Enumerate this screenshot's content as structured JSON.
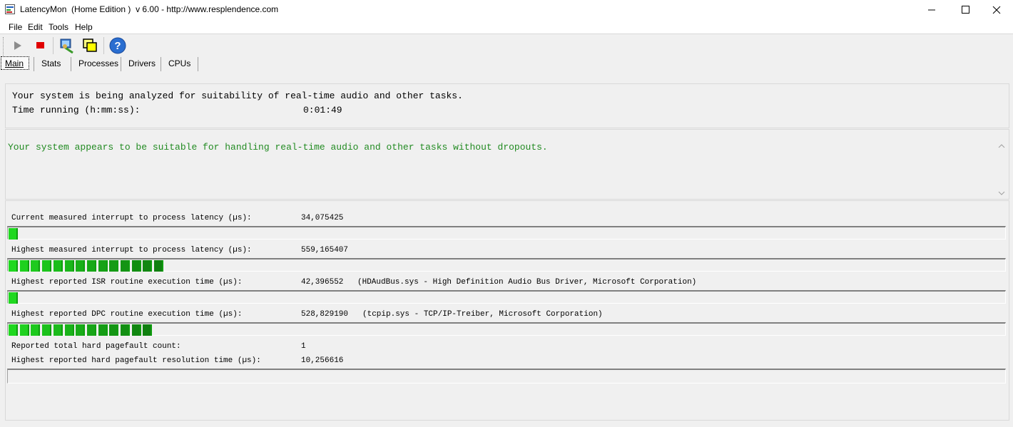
{
  "window": {
    "title": "LatencyMon  (Home Edition )  v 6.00 - http://www.resplendence.com",
    "icons": [
      "app-icon",
      "minimize-icon",
      "maximize-icon",
      "close-icon"
    ]
  },
  "menu": [
    "File",
    "Edit",
    "Tools",
    "Help"
  ],
  "toolbar": {
    "icons": [
      "play-icon",
      "stop-icon",
      "cpu-tool-icon",
      "windows-icon",
      "help-icon"
    ]
  },
  "tabs": [
    "Main",
    "Stats",
    "Processes",
    "Drivers",
    "CPUs"
  ],
  "status": {
    "line1": "Your system is being analyzed for suitability of real-time audio and other tasks.",
    "time_label": "Time running (h:mm:ss):",
    "time_value": "0:01:49"
  },
  "verdict": {
    "text": "Your system appears to be suitable for handling real-time audio and other tasks without dropouts.",
    "color": "#228b22"
  },
  "metrics": {
    "current_label": "Current measured interrupt to process latency (µs):",
    "current_value": "34,075425",
    "current_level": 1,
    "highest_label": "Highest measured interrupt to process latency (µs):",
    "highest_value": "559,165407",
    "highest_level": 14,
    "isr_label": "Highest reported ISR routine execution time (µs):",
    "isr_value": "42,396552",
    "isr_driver": "(HDAudBus.sys - High Definition Audio Bus Driver, Microsoft Corporation)",
    "isr_level": 1,
    "dpc_label": "Highest reported DPC routine execution time (µs):",
    "dpc_value": "528,829190",
    "dpc_driver": "(tcpip.sys - TCP/IP-Treiber, Microsoft Corporation)",
    "dpc_level": 13,
    "pf_count_label": "Reported total hard pagefault count:",
    "pf_count_value": "1",
    "pf_time_label": "Highest reported hard pagefault resolution time (µs):",
    "pf_time_value": "10,256616",
    "pf_level": 0
  }
}
